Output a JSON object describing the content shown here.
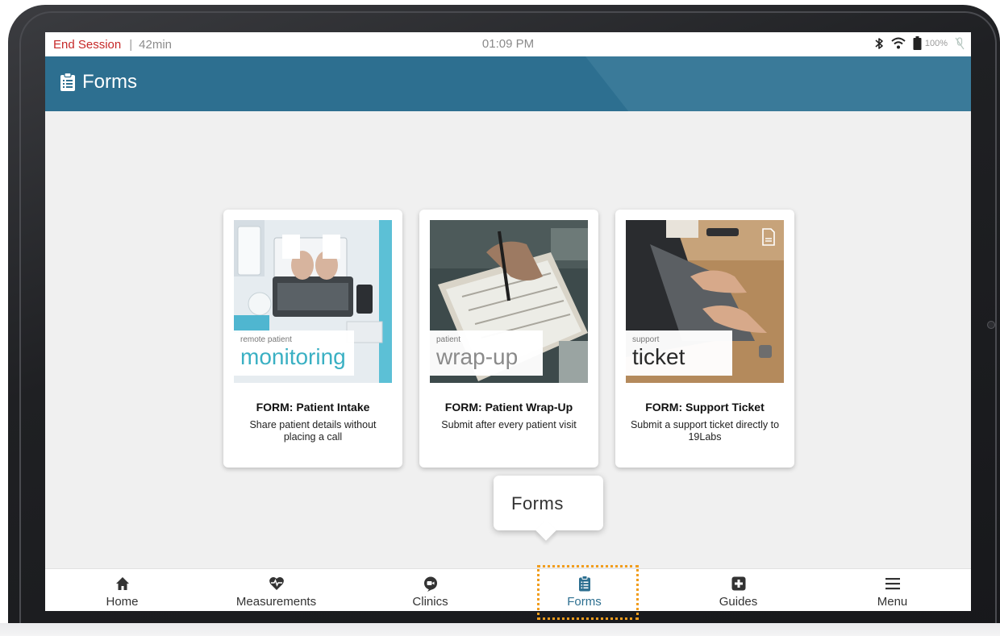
{
  "status_bar": {
    "end_session": "End Session",
    "separator": "|",
    "session_time": "42min",
    "clock": "01:09 PM",
    "battery": "100%",
    "icons": [
      "bluetooth-icon",
      "wifi-icon",
      "battery-icon",
      "mic-off-icon"
    ]
  },
  "header": {
    "title": "Forms",
    "icon": "clipboard-icon",
    "color": "#2d6f90"
  },
  "cards": [
    {
      "image_small": "remote patient",
      "image_big": "monitoring",
      "image_color": "#3ab0c3",
      "title": "FORM: Patient Intake",
      "description": "Share patient details without placing a call"
    },
    {
      "image_small": "patient",
      "image_big": "wrap-up",
      "image_color": "#8a8a8a",
      "title": "FORM: Patient Wrap-Up",
      "description": "Submit after every patient visit"
    },
    {
      "image_small": "support",
      "image_big": "ticket",
      "image_color": "#2a2a2a",
      "title": "FORM: Support Ticket",
      "description": "Submit a support ticket directly to 19Labs"
    }
  ],
  "nav": {
    "items": [
      {
        "label": "Home",
        "icon": "home-icon"
      },
      {
        "label": "Measurements",
        "icon": "heart-pulse-icon"
      },
      {
        "label": "Clinics",
        "icon": "video-chat-icon"
      },
      {
        "label": "Forms",
        "icon": "clipboard-icon",
        "active": true
      },
      {
        "label": "Guides",
        "icon": "plus-square-icon"
      },
      {
        "label": "Menu",
        "icon": "hamburger-icon"
      }
    ]
  },
  "tooltip": {
    "text": "Forms"
  },
  "colors": {
    "accent": "#2d6f90",
    "end_session": "#c62828",
    "highlight": "#f19d1d"
  }
}
